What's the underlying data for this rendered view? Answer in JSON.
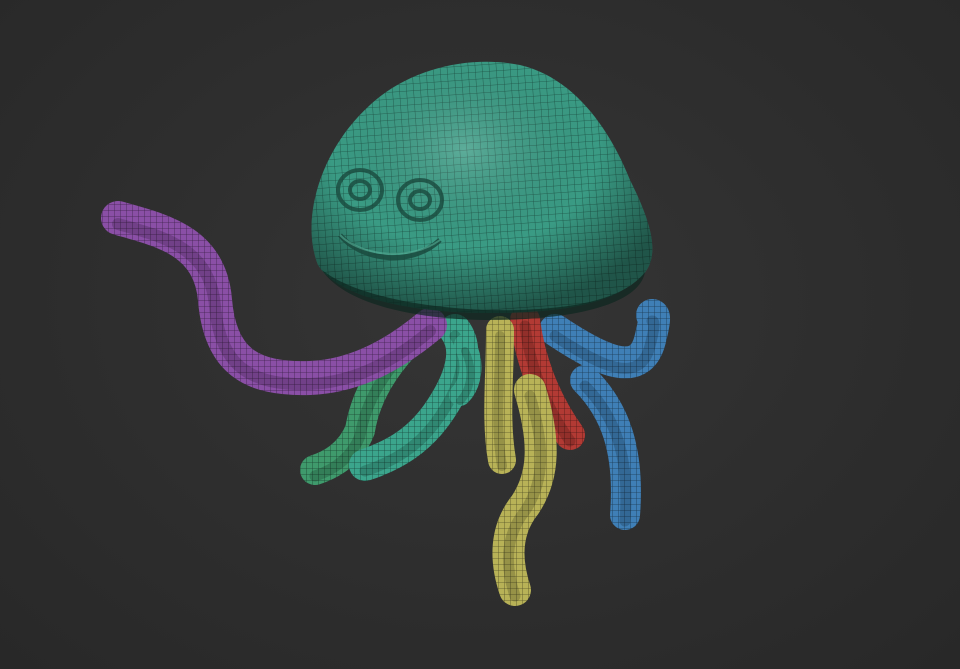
{
  "subject": {
    "head_color": "#3a9b84",
    "tentacle_colors": {
      "purple": "#8a4fa6",
      "green": "#3f9a6c",
      "teal": "#3ba58c",
      "yellow": "#b8b257",
      "red": "#b23a34",
      "blue": "#3f7fb6"
    }
  },
  "viewport": {
    "background": "#2f2f2f"
  }
}
